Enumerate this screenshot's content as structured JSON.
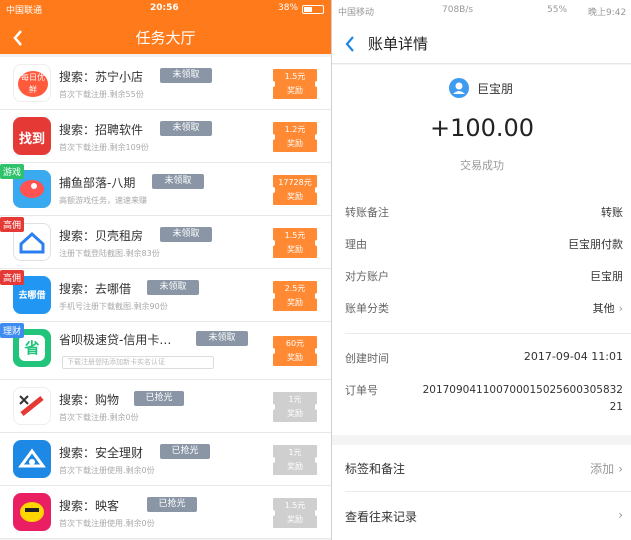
{
  "left": {
    "status": {
      "carrier": "中国联通",
      "time": "20:56",
      "battery": "38%"
    },
    "header": {
      "title": "任务大厅",
      "back_icon": "chevron-left-icon"
    },
    "tasks": [
      {
        "icon": "suning-icon",
        "icon_text": "每日优鲜",
        "tag": "",
        "tag_color": "",
        "name": "搜索：苏宁小店",
        "badge": "未领取",
        "desc": "首次下载注册.剩余55份",
        "reward_amount": "1.5元",
        "reward_label": "奖励",
        "done": false
      },
      {
        "icon": "zhaopin-icon",
        "icon_text": "找到",
        "tag": "",
        "tag_color": "",
        "name": "搜索：招聘软件",
        "badge": "未领取",
        "desc": "首次下载注册.剩余109份",
        "reward_amount": "1.2元",
        "reward_label": "奖励",
        "done": false
      },
      {
        "icon": "fish-game-icon",
        "icon_text": "",
        "tag": "游戏",
        "tag_color": "#2ec26a",
        "name": "捕鱼部落-八期",
        "badge": "未领取",
        "desc": "高额游戏任务，速速来赚",
        "reward_amount": "17728元",
        "reward_label": "奖励",
        "done": false
      },
      {
        "icon": "beike-icon",
        "icon_text": "",
        "tag": "高佣",
        "tag_color": "#e53935",
        "name": "搜索：贝壳租房",
        "badge": "未领取",
        "desc": "注册下载登陆截图.剩余83份",
        "reward_amount": "1.5元",
        "reward_label": "奖励",
        "done": false
      },
      {
        "icon": "qunajie-icon",
        "icon_text": "去哪借",
        "tag": "高佣",
        "tag_color": "#e53935",
        "name": "搜索：去哪借",
        "badge": "未领取",
        "desc": "手机号注册下载截图.剩余90份",
        "reward_amount": "2.5元",
        "reward_label": "奖励",
        "done": false
      },
      {
        "icon": "shengbei-icon",
        "icon_text": "省",
        "tag": "理财",
        "tag_color": "#3f8cf0",
        "name": "省呗极速贷-信用卡…",
        "badge": "未领取",
        "desc": "",
        "tip": "下载注册登陆添加新卡实名认证",
        "reward_amount": "60元",
        "reward_label": "奖励",
        "done": false
      },
      {
        "icon": "gouwu-icon",
        "icon_text": "",
        "tag": "",
        "tag_color": "",
        "name": "搜索：购物",
        "badge": "已抢光",
        "desc": "首次下载注册.剩余0份",
        "reward_amount": "1元",
        "reward_label": "奖励",
        "done": true
      },
      {
        "icon": "anquan-icon",
        "icon_text": "",
        "tag": "",
        "tag_color": "",
        "name": "搜索：安全理财",
        "badge": "已抢光",
        "desc": "首次下载注册使用.剩余0份",
        "reward_amount": "1元",
        "reward_label": "奖励",
        "done": true
      },
      {
        "icon": "yingke-icon",
        "icon_text": "",
        "tag": "",
        "tag_color": "",
        "name": "搜索：映客",
        "badge": "已抢光",
        "desc": "首次下载注册使用.剩余0份",
        "reward_amount": "1.5元",
        "reward_label": "奖励",
        "done": true
      }
    ]
  },
  "right": {
    "status": {
      "carrier": "中国移动",
      "speed": "708B/s",
      "battery": "55%",
      "time": "晚上9:42"
    },
    "header": {
      "title": "账单详情",
      "back_icon": "chevron-left-icon"
    },
    "payer": "巨宝朋",
    "amount": "+100.00",
    "status_text": "交易成功",
    "rows": [
      {
        "label": "转账备注",
        "value": "转账"
      },
      {
        "label": "理由",
        "value": "巨宝朋付款"
      },
      {
        "label": "对方账户",
        "value": "巨宝朋"
      },
      {
        "label": "账单分类",
        "value": "其他"
      }
    ],
    "created": {
      "label": "创建时间",
      "value": "2017-09-04 11:01"
    },
    "order": {
      "label": "订单号",
      "value_line1": "201709041100700015025600305832",
      "value_line2": "21"
    },
    "bottom": [
      {
        "label": "标签和备注",
        "value": "添加"
      },
      {
        "label": "查看往来记录",
        "value": ""
      }
    ]
  }
}
